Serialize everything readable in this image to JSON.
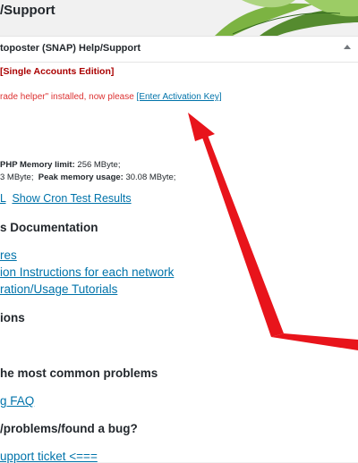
{
  "header": {
    "title": "/Support"
  },
  "panel": {
    "title": "toposter (SNAP) Help/Support",
    "edition": "[Single Accounts Edition]",
    "notice_text": "rade helper\" installed, now please ",
    "notice_link": "[Enter Activation Key]"
  },
  "memory": {
    "label1": "PHP Memory limit:",
    "value1": "256 MByte;",
    "prefix2": "3 MByte;",
    "label2": "Peak memory usage:",
    "value2": "30.08 MByte;"
  },
  "cron": {
    "left_link": "L",
    "test_link": "Show Cron Test Results"
  },
  "docs": {
    "heading": "s Documentation",
    "links": [
      "res",
      "ion Instructions for each network",
      "ration/Usage Tutorials"
    ]
  },
  "sections": {
    "options_heading": "ions",
    "problems_heading": "he most common problems",
    "faq_link": "g FAQ",
    "bug_heading": "/problems/found a bug?",
    "ticket_link": "upport ticket <==="
  },
  "colors": {
    "accent_link": "#0073aa",
    "notice_red": "#dc3232",
    "edition_red": "#aa0000",
    "arrow_red": "#e8141b"
  }
}
